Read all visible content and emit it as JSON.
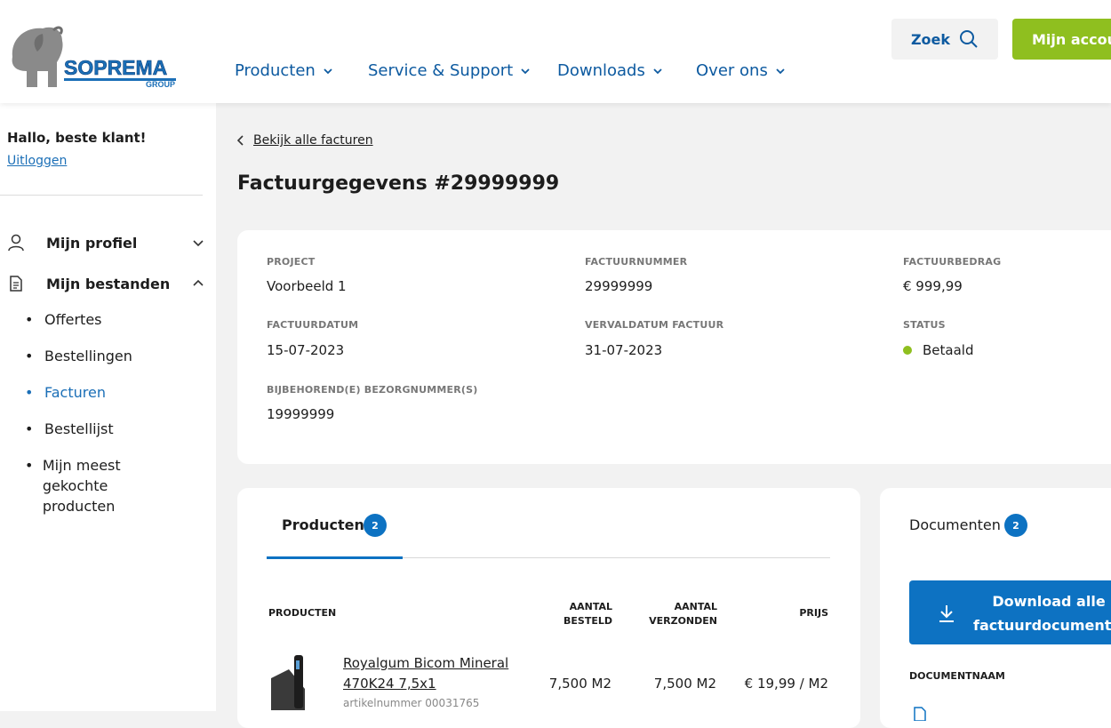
{
  "header": {
    "logo_text": "SOPREMA",
    "logo_sub": "GROUP",
    "nav": [
      {
        "label": "Producten"
      },
      {
        "label": "Service & Support"
      },
      {
        "label": "Downloads"
      },
      {
        "label": "Over ons"
      }
    ],
    "search_label": "Zoek",
    "account_label": "Mijn account"
  },
  "sidebar": {
    "greeting": "Hallo, beste klant!",
    "logout": "Uitloggen",
    "profile": "Mijn profiel",
    "files": "Mijn bestanden",
    "items": [
      {
        "label": "Offertes"
      },
      {
        "label": "Bestellingen"
      },
      {
        "label": "Facturen"
      },
      {
        "label": "Bestellijst"
      },
      {
        "label": "Mijn meest gekochte producten"
      }
    ]
  },
  "main": {
    "back_link": "Bekijk alle facturen",
    "title": "Factuurgegevens #29999999",
    "details": {
      "project_label": "PROJECT",
      "project_value": "Voorbeeld 1",
      "number_label": "FACTUURNUMMER",
      "number_value": "29999999",
      "amount_label": "FACTUURBEDRAG",
      "amount_value": "€ 999,99",
      "date_label": "FACTUURDATUM",
      "date_value": "15-07-2023",
      "due_label": "VERVALDATUM FACTUUR",
      "due_value": "31-07-2023",
      "status_label": "STATUS",
      "status_value": "Betaald",
      "delivery_label": "BIJBEHOREND(E) BEZORGNUMMER(S)",
      "delivery_value": "19999999"
    },
    "products": {
      "tab": "Producten",
      "count": "2",
      "col_product": "PRODUCTEN",
      "col_ordered": "AANTAL BESTELD",
      "col_shipped": "AANTAL VERZONDEN",
      "col_price": "PRIJS",
      "rows": [
        {
          "name": "Royalgum Bicom Mineral 470K24 7,5x1",
          "article": "artikelnummer 00031765",
          "ordered": "7,500 M2",
          "shipped": "7,500 M2",
          "price": "€ 19,99 / M2"
        }
      ]
    },
    "documents": {
      "tab": "Documenten",
      "count": "2",
      "download_all": "Download alle factuurdocumenten",
      "col_name": "DOCUMENTNAAM"
    }
  },
  "colors": {
    "primary_blue": "#0d5aa0",
    "accent_green": "#8fbf1f",
    "badge_blue": "#0d72c2"
  }
}
